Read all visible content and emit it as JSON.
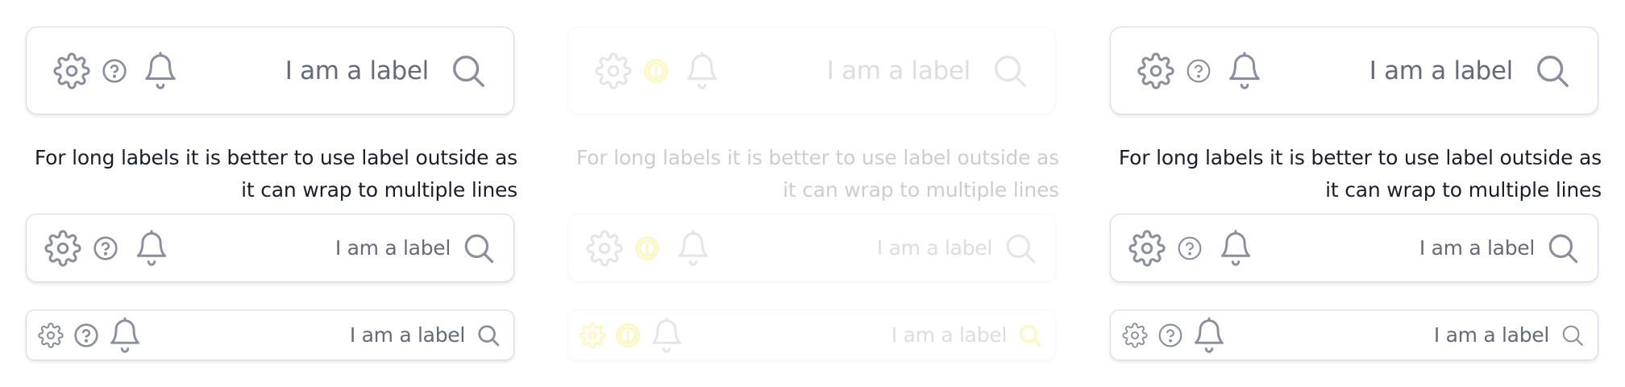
{
  "variants": [
    {
      "state": "default",
      "large_field": {
        "label": "I am a label"
      },
      "helper_text": "For long labels it is better to use label outside as it can wrap to multiple lines",
      "medium_field": {
        "label": "I am a label"
      },
      "small_field": {
        "label": "I am a label"
      }
    },
    {
      "state": "disabled",
      "large_field": {
        "label": "I am a label"
      },
      "helper_text": "For long labels it is better to use label outside as it can wrap to multiple lines",
      "medium_field": {
        "label": "I am a label"
      },
      "small_field": {
        "label": "I am a label"
      }
    },
    {
      "state": "default",
      "large_field": {
        "label": "I am a label"
      },
      "helper_text": "For long labels it is better to use label outside as it can wrap to multiple lines",
      "medium_field": {
        "label": "I am a label"
      },
      "small_field": {
        "label": "I am a label"
      }
    }
  ],
  "icons": [
    "gear-icon",
    "help-icon",
    "bell-icon",
    "search-icon"
  ],
  "colors": {
    "icon": "#8b8e9b",
    "label": "#676a76",
    "helper_text": "#1b1e2b",
    "border": "#d7d9e0",
    "focus_highlight": "#f2e300"
  }
}
